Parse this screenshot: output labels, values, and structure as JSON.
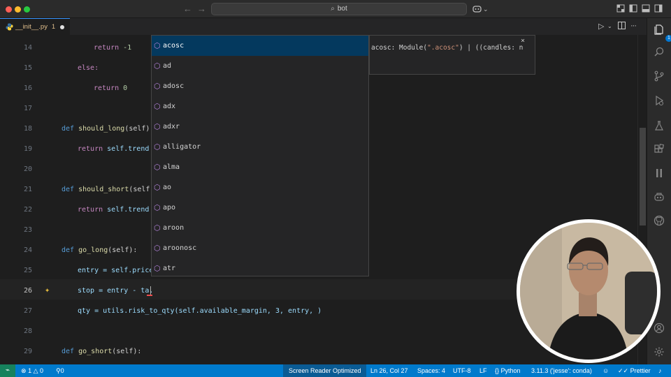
{
  "titlebar": {
    "search_text": "bot",
    "search_icon": "search-icon",
    "copilot_chevron": "⌄"
  },
  "tab": {
    "filename": "__init__.py",
    "problem_count": "1",
    "file_icon": "python-file-icon"
  },
  "editor": {
    "lines": [
      {
        "n": "14"
      },
      {
        "n": "15"
      },
      {
        "n": "16"
      },
      {
        "n": "17"
      },
      {
        "n": "18"
      },
      {
        "n": "19"
      },
      {
        "n": "20"
      },
      {
        "n": "21"
      },
      {
        "n": "22"
      },
      {
        "n": "23"
      },
      {
        "n": "24"
      },
      {
        "n": "25"
      },
      {
        "n": "26"
      },
      {
        "n": "27"
      },
      {
        "n": "28"
      },
      {
        "n": "29"
      }
    ],
    "code": {
      "l14_kw": "return",
      "l14_num": "-1",
      "l15_kw": "else:",
      "l16_kw": "return",
      "l16_num": "0",
      "l18_def": "def",
      "l18_fn": "should_long",
      "l18_rest": "(self):",
      "l19_kw": "return",
      "l19_rest": "self.trend",
      "l21_def": "def",
      "l21_fn": "should_short",
      "l21_rest": "(self):",
      "l22_kw": "return",
      "l22_rest": "self.trend",
      "l24_def": "def",
      "l24_fn": "go_long",
      "l24_rest": "(self):",
      "l25_text": "entry = self.price",
      "l26_text": "stop = entry - ta.",
      "l27_text": "qty = utils.risk_to_qty(self.available_margin, 3, entry, )",
      "l29_def": "def",
      "l29_fn": "go_short",
      "l29_rest": "(self):"
    }
  },
  "suggest": {
    "items": [
      {
        "label": "acosc"
      },
      {
        "label": "ad"
      },
      {
        "label": "adosc"
      },
      {
        "label": "adx"
      },
      {
        "label": "adxr"
      },
      {
        "label": "alligator"
      },
      {
        "label": "alma"
      },
      {
        "label": "ao"
      },
      {
        "label": "apo"
      },
      {
        "label": "aroon"
      },
      {
        "label": "aroonosc"
      },
      {
        "label": "atr"
      }
    ],
    "item_icon": "module-icon"
  },
  "details": {
    "sig_a": "acosc: Module(",
    "sig_str": "\".acosc\"",
    "sig_b": ") | ((candles: n",
    "close": "×"
  },
  "activity": {
    "items": [
      "explorer-icon",
      "search-icon",
      "source-control-icon",
      "run-debug-icon",
      "testing-icon",
      "extensions-icon",
      "pause-icon",
      "copilot-icon",
      "github-icon",
      "account-icon",
      "settings-icon"
    ],
    "explorer_badge": "1"
  },
  "statusbar": {
    "errors": "1",
    "warnings": "0",
    "ports": "0",
    "screen_reader": "Screen Reader Optimized",
    "position": "Ln 26, Col 27",
    "spaces": "Spaces: 4",
    "encoding": "UTF-8",
    "eol": "LF",
    "language": "Python",
    "interpreter": "3.11.3 ('jesse': conda)",
    "prettier": "Prettier",
    "accent": "#007acc"
  }
}
